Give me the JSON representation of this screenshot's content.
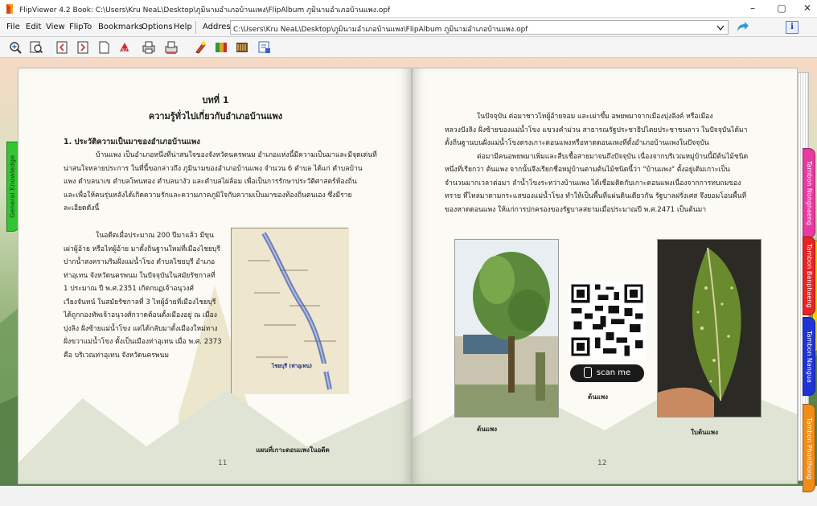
{
  "window": {
    "title": "FlipViewer 4.2   Book: C:\\Users\\Kru NeaL\\Desktop\\ภูมินามอำเภอบ้านแพง\\FlipAlbum ภูมินามอำเภอบ้านแพง.opf",
    "minimize": "–",
    "maximize": "▢",
    "close": "✕"
  },
  "menu": {
    "items": [
      "File",
      "Edit",
      "View",
      "FlipTo",
      "Bookmarks",
      "Options",
      "Help"
    ],
    "address_label": "Address",
    "address_value": "C:\\Users\\Kru NeaL\\Desktop\\ภูมินามอำเภอบ้านแพง\\FlipAlbum ภูมินามอำเภอบ้านแพง.opf",
    "info_label": "i"
  },
  "toolbar": {
    "icons": [
      "zoom-in-icon",
      "zoom-out-icon",
      "prev-page-icon",
      "next-page-icon",
      "blank-page-icon",
      "auto-flip-icon",
      "print-icon",
      "print-preview-icon",
      "tools-icon",
      "contents-icon",
      "index-icon",
      "bookmark-icon"
    ]
  },
  "left_page": {
    "chapter": "บทที่ 1",
    "chapter_title": "ความรู้ทั่วไปเกี่ยวกับอำเภอบ้านแพง",
    "section": "1. ประวัติความเป็นมาของอำเภอบ้านแพง",
    "para1": [
      "บ้านแพง เป็นอำเภอหนึ่งที่น่าสนใจของจังหวัดนครพนม อำเภอแห่งนี้มีความเป็นมาและมีจุดเด่นที่",
      "น่าสนใจหลายประการ ในที่นี้ขอกล่าวถึง ภูมินามของอำเภอบ้านแพง จำนวน 6 ตำบล ได้แก่ ตำบลบ้าน",
      "แพง ตำบลนาเข ตำบลโพนทอง ตำบลนางัว และตำบลไผ่ล้อม เพื่อเป็นการรักษาประวัติศาสตร์ท้องถิ่น",
      "และเพื่อให้คนรุ่นหลังได้เกิดความรักและความภาคภูมิใจกับความเป็นมาของท้องถิ่นตนเอง ซึ่งมีราย",
      "ละเอียดดังนี้"
    ],
    "para2": [
      "ในอดีตเมื่อประมาณ 200 ปีมาแล้ว มีขุน",
      "เผ่าผู้อ้าย หรือไทผู้อ้าย มาตั้งถิ่นฐานใหม่ที่เมืองไชยบุรี",
      "ปากน้ำสงครามริมฝั่งแม่น้ำโขง ตำบลไชยบุรี อำเภอ",
      "ท่าอุเทน จังหวัดนครพนม ในปัจจุบันในสมัยรัชกาลที่",
      "1 ประมาณ ปี พ.ศ.2351 เกิดกบฏเจ้าอนุวงศ์",
      "เวียงจันทน์ ในสมัยรัชกาลที่ 3 ไทผู้อ้ายที่เมืองไชยบุรี",
      "ได้ถูกกองทัพเจ้าอนุวงศ์กวาดต้อนตั้งเมืองอยู่ ณ เมือง",
      "ปุงลิง ฝั่งซ้ายแม่น้ำโขง แต่ได้กลับมาตั้งเมืองใหม่ทาง",
      "ฝั่งขวาแม่น้ำโขง ตั้งเป็นเมืองท่าอุเทน เมื่อ พ.ศ. 2373",
      "คือ บริเวณท่าอุเทน จังหวัดนครพนม"
    ],
    "map_label": "ไชยบุรี (ท่าอุเทน)",
    "map_caption": "แผนที่เกาะดอนแพงในอดีต",
    "page_number": "11"
  },
  "right_page": {
    "para1": [
      "ในปัจจุบัน ต่อมาชาวไทผู้อ้ายจอม และเผ่าขึ้ม อพยพมาจากเมืองปุงลิงค์ หรือเมือง",
      "หลวงปังลิง ฝั่งซ้ายของแม่น้ำโขง แขวงคำม่วน สาธารณรัฐประชาธิปไตยประชาชนลาว ในปัจจุบันได้มา",
      "ตั้งถิ่นฐานบนฝั่งแม่น้ำโขงตรงเกาะดอนแพงหรือหาดดอนแพงที่ตั้งอำเภอบ้านแพงในปัจจุบัน",
      "ต่อมามีคนอพยพมาเพิ่มและสืบเชื้อสายมาจนถึงปัจจุบัน เนื่องจากบริเวณหมู่บ้านนี้มีต้นไม้ชนิด",
      "หนึ่งที่เรียกว่า ต้นแพง จากนั้นจึงเรียกชื่อหมู่บ้านตามต้นไม้ชนิดนี้ว่า \"บ้านแพง\" ตั้งอยู่เดิมเกาะเป็น",
      "จำนวนมากเวลาต่อมา ลำน้ำโขงระหว่างบ้านแพง ได้เชื่อมติดกับเกาะดอนแพงเนื่องจากการทบถมของ",
      "ทราย ที่ไหลมาตามกระแสของแม่น้ำโขง ทำให้เป็นพื้นที่แผ่นดินเดียวกัน รัฐบาลฝรั่งเศส จึงยอมโอนพื้นที่",
      "ของหาดดอนแพง ให้แก่การปกครองของรัฐบาลสยามเมื่อประมาณปี พ.ศ.2471 เป็นต้นมา"
    ],
    "scan_me": "scan me",
    "caption_left": "ต้นแพง",
    "caption_qr": "ต้นแพง",
    "caption_right": "ใบต้นแพง",
    "page_number": "12"
  },
  "tabs": {
    "general": "General Knowledge",
    "nongnaeng": "Tambon Nongnaeng",
    "banphaeng": "Tambon Banphaeng",
    "nangua": "Tambon Nangua",
    "phonthong": "Tambon Phonthong"
  },
  "colors": {
    "tab_general": "#33c533",
    "tab_nongnaeng": "#e83aa0",
    "tab_banphaeng": "#e82424",
    "tab_kuy": "#f2d400",
    "tab_nangua": "#1f34d6",
    "tab_phonthong": "#f28c18"
  }
}
